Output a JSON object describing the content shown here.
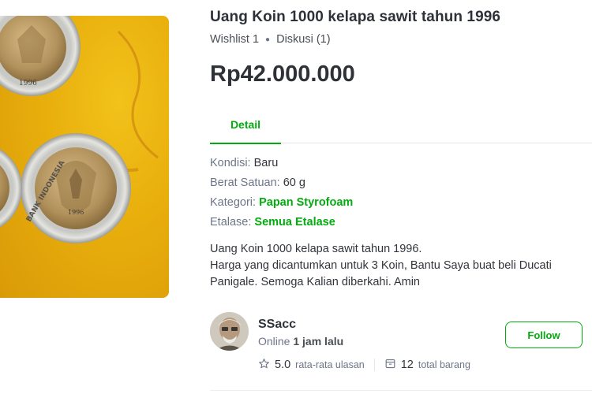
{
  "product": {
    "title": "Uang Koin 1000 kelapa sawit tahun 1996",
    "wishlist": "Wishlist 1",
    "discussion": "Diskusi (1)",
    "price": "Rp42.000.000"
  },
  "tabs": {
    "detail": "Detail"
  },
  "specs": {
    "condition_label": "Kondisi: ",
    "condition_value": "Baru",
    "weight_label": "Berat Satuan: ",
    "weight_value": "60 g",
    "category_label": "Kategori: ",
    "category_value": "Papan Styrofoam",
    "showcase_label": "Etalase: ",
    "showcase_value": "Semua Etalase"
  },
  "description": {
    "line1": "Uang Koin 1000 kelapa sawit tahun 1996.",
    "line2": "Harga yang dicantumkan untuk 3 Koin, Bantu Saya buat beli Ducati",
    "line3": "Panigale. Semoga Kalian diberkahi. Amin"
  },
  "shop": {
    "name": "SSacc",
    "online_prefix": "Online ",
    "online_time": "1 jam lalu",
    "follow_label": "Follow",
    "rating": "5.0",
    "rating_label": "rata-rata ulasan",
    "items": "12",
    "items_label": "total barang"
  },
  "coin_text": {
    "year": "1996",
    "legend": "BANK INDONESIA"
  },
  "colors": {
    "accent": "#03ac0e",
    "text": "#31353b",
    "muted": "#6d7588",
    "photo_bg": "#e8ae0c"
  },
  "icons": [
    "star-icon",
    "box-icon"
  ]
}
